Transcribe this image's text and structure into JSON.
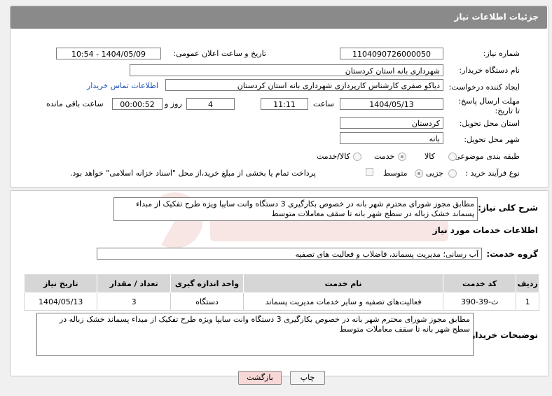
{
  "header": {
    "title": "جزئیات اطلاعات نیاز"
  },
  "fields": {
    "need_number_label": "شماره نیاز:",
    "need_number": "1104090726000050",
    "announce_label": "تاریخ و ساعت اعلان عمومی:",
    "announce_value": "1404/05/09 - 10:54",
    "buyer_org_label": "نام دستگاه خریدار:",
    "buyer_org": "شهرداری بانه استان کردستان",
    "creator_label": "ایجاد کننده درخواست:",
    "creator": "دیاکو صفری کارشناس کارپردازی شهرداری بانه استان کردستان",
    "contact_link": "اطلاعات تماس خریدار",
    "deadline_label": "مهلت ارسال پاسخ: تا تاریخ:",
    "deadline_date": "1404/05/13",
    "time_label": "ساعت",
    "deadline_time": "11:11",
    "days_value": "4",
    "days_label": "روز و",
    "remaining_time": "00:00:52",
    "remaining_label": "ساعت باقی مانده",
    "province_label": "استان محل تحویل:",
    "province": "کردستان",
    "city_label": "شهر محل تحویل:",
    "city": "بانه",
    "category_label": "طبقه بندی موضوعی:",
    "category_options": [
      "کالا",
      "خدمت",
      "کالا/خدمت"
    ],
    "category_selected": "خدمت",
    "process_label": "نوع فرآیند خرید :",
    "process_options": [
      "جزیی",
      "متوسط"
    ],
    "process_selected": "متوسط",
    "payment_note": "پرداخت تمام یا بخشی از مبلغ خرید،از محل \"اسناد خزانه اسلامی\" خواهد بود."
  },
  "summary": {
    "label": "شرح کلی نیاز:",
    "text": "مطابق مجوز شورای محترم شهر بانه در خصوص بکارگیری 3 دستگاه وانت سایپا ویژه طرح تفکیک از مبداء پسماند خشک زباله در سطح شهر بانه تا سقف معاملات متوسط"
  },
  "services": {
    "section_title": "اطلاعات خدمات مورد نیاز",
    "group_label": "گروه خدمت:",
    "group_value": "آب رسانی؛ مدیریت پسماند، فاضلاب و فعالیت های تصفیه",
    "columns": [
      "ردیف",
      "کد خدمت",
      "نام خدمت",
      "واحد اندازه گیری",
      "تعداد / مقدار",
      "تاریخ نیاز"
    ],
    "rows": [
      [
        "1",
        "ث-39-390",
        "فعالیت‌های تصفیه و سایر خدمات مدیریت پسماند",
        "دستگاه",
        "3",
        "1404/05/13"
      ]
    ]
  },
  "buyer_notes": {
    "label": "توضیحات خریدار:",
    "text": "مطابق مجوز شورای محترم شهر بانه در خصوص بکارگیری 3 دستگاه وانت سایپا ویژه طرح تفکیک از مبداء پسماند خشک زباله در سطح شهر بانه تا سقف معاملات متوسط"
  },
  "buttons": {
    "print": "چاپ",
    "back": "بازگشت"
  }
}
